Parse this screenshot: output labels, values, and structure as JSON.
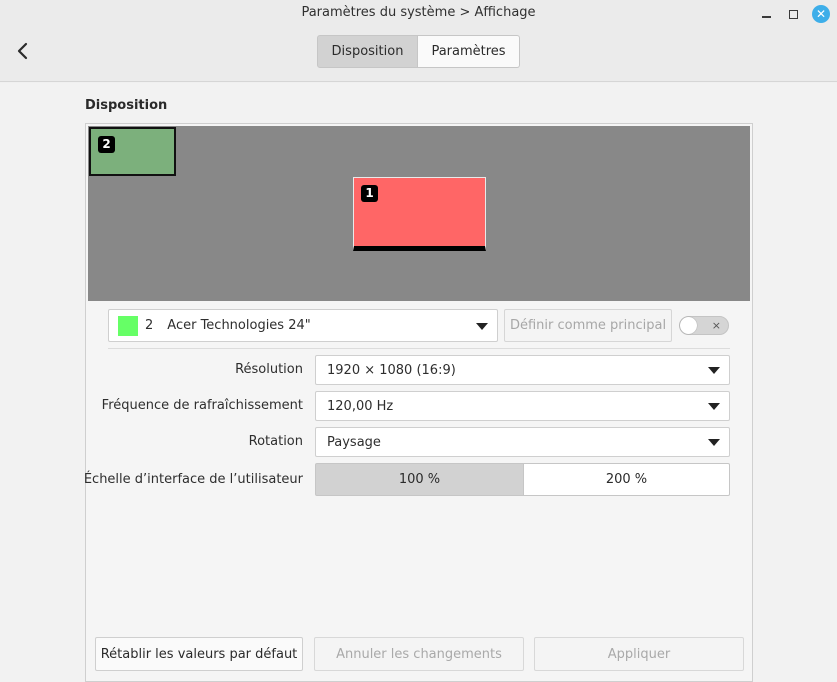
{
  "window": {
    "title": "Paramètres du système > Affichage",
    "close_glyph": "✕"
  },
  "header": {
    "tabs": [
      {
        "label": "Disposition",
        "active": true
      },
      {
        "label": "Paramètres",
        "active": false
      }
    ]
  },
  "layout": {
    "section_title": "Disposition",
    "monitors": [
      {
        "number": "1",
        "color": "#ff6666"
      },
      {
        "number": "2",
        "color": "#7cb07c"
      }
    ]
  },
  "monitor_settings": {
    "selected_monitor": {
      "number": "2",
      "name": "Acer Technologies 24\"",
      "swatch_color": "#66ff66"
    },
    "set_primary_label": "Définir comme principal",
    "enabled_toggle": {
      "on": false,
      "off_glyph": "×"
    },
    "resolution": {
      "label": "Résolution",
      "value": "1920 × 1080 (16:9)"
    },
    "refresh_rate": {
      "label": "Fréquence de rafraîchissement",
      "value": "120,00 Hz"
    },
    "rotation": {
      "label": "Rotation",
      "value": "Paysage"
    },
    "ui_scale": {
      "label": "Échelle d’interface de l’utilisateur",
      "options": [
        {
          "label": "100 %",
          "active": true
        },
        {
          "label": "200 %",
          "active": false
        }
      ]
    }
  },
  "footer": {
    "reset_label": "Rétablir les valeurs par défaut",
    "revert_label": "Annuler les changements",
    "apply_label": "Appliquer"
  },
  "icons": {
    "back": "chevron-left-icon",
    "minimize": "minimize-icon",
    "maximize": "maximize-icon",
    "close": "close-icon"
  },
  "colors": {
    "accent": "#3daee9",
    "canvas": "#888888"
  }
}
